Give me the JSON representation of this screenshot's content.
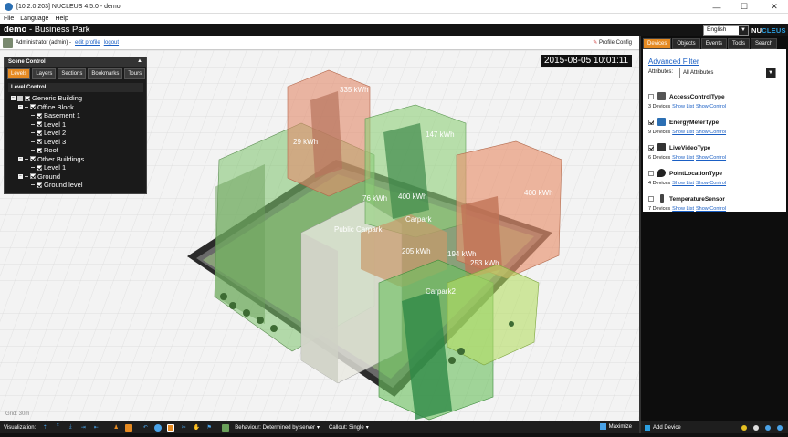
{
  "window": {
    "title": "[10.2.0.203] NUCLEUS 4.5.0 - demo",
    "min": "—",
    "max": "☐",
    "close": "✕"
  },
  "menu": {
    "items": [
      "File",
      "Language",
      "Help"
    ]
  },
  "header": {
    "site": "demo",
    "separator": " - ",
    "project": "Business Park",
    "language": "English",
    "logo_prefix": "NU",
    "logo_suffix": "CLEUS"
  },
  "user": {
    "name": "Administrator (admin) -",
    "edit_profile": "edit profile",
    "logout": "logout",
    "profile_config": "Profile Config"
  },
  "viewport": {
    "timestamp": "2015-08-05 10:01:11",
    "grid": "Grid: 30m",
    "labels": [
      {
        "text": "335 kWh"
      },
      {
        "text": "29 kWh"
      },
      {
        "text": "147 kWh"
      },
      {
        "text": "76 kWh"
      },
      {
        "text": "400 kWh"
      },
      {
        "text": "400 kWh"
      },
      {
        "text": "Carpark"
      },
      {
        "text": "Public Carpark"
      },
      {
        "text": "205 kWh"
      },
      {
        "text": "194 kWh"
      },
      {
        "text": "253 kWh"
      },
      {
        "text": "Carpark2"
      }
    ]
  },
  "scene_control": {
    "title": "Scene Control",
    "tabs": [
      "Levels",
      "Layers",
      "Sections",
      "Bookmarks",
      "Tours"
    ],
    "level_control": "Level Control",
    "tree": [
      {
        "label": "Generic Building",
        "depth": 0,
        "type": "root"
      },
      {
        "label": "Office Block",
        "depth": 1,
        "type": "group"
      },
      {
        "label": "Basement 1",
        "depth": 2,
        "type": "leaf"
      },
      {
        "label": "Level 1",
        "depth": 2,
        "type": "leaf"
      },
      {
        "label": "Level 2",
        "depth": 2,
        "type": "leaf"
      },
      {
        "label": "Level 3",
        "depth": 2,
        "type": "leaf"
      },
      {
        "label": "Roof",
        "depth": 2,
        "type": "leaf"
      },
      {
        "label": "Other Buildings",
        "depth": 1,
        "type": "group"
      },
      {
        "label": "Level 1",
        "depth": 2,
        "type": "leaf"
      },
      {
        "label": "Ground",
        "depth": 1,
        "type": "group"
      },
      {
        "label": "Ground level",
        "depth": 2,
        "type": "leaf"
      }
    ]
  },
  "toolbar": {
    "visualization": "Visualization:",
    "behaviour": "Behaviour: Determined by server",
    "callout": "Callout: Single",
    "maximize": "Maximize"
  },
  "right_panel": {
    "tabs": [
      "Devices",
      "Objects",
      "Events",
      "Tools",
      "Search"
    ],
    "advanced_filter": "Advanced Filter",
    "attributes_label": "Attributes:",
    "attributes_value": "All Attributes",
    "show_list": "Show List",
    "show_control": "Show Control",
    "types": [
      {
        "name": "AccessControlType",
        "count": "3 Devices",
        "checked": false
      },
      {
        "name": "EnergyMeterType",
        "count": "9 Devices",
        "checked": true
      },
      {
        "name": "LiveVideoType",
        "count": "6 Devices",
        "checked": true
      },
      {
        "name": "PointLocationType",
        "count": "4 Devices",
        "checked": false
      },
      {
        "name": "TemperatureSensor",
        "count": "7 Devices",
        "checked": false
      }
    ],
    "add_device": "Add Device"
  }
}
